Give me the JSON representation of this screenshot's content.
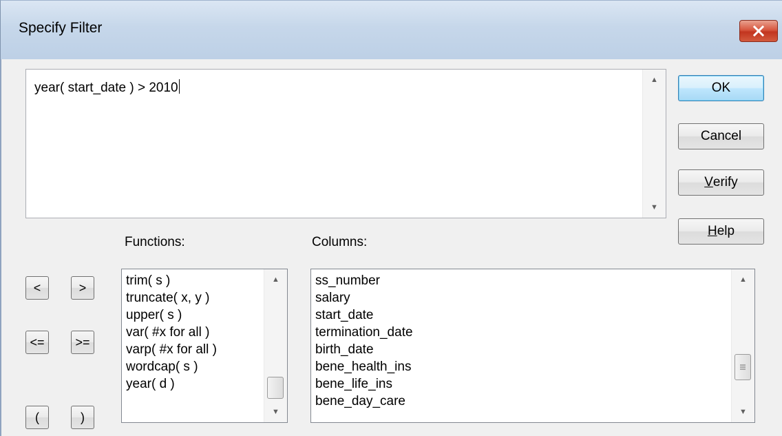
{
  "window": {
    "title": "Specify Filter"
  },
  "editor": {
    "text": "year( start_date ) > 2010"
  },
  "buttons": {
    "ok": "OK",
    "cancel": "Cancel",
    "verify_accel": "V",
    "verify_rest": "erify",
    "help_accel": "H",
    "help_rest": "elp"
  },
  "operators": [
    "<",
    ">",
    "<=",
    ">=",
    "(",
    ")"
  ],
  "functions": {
    "label": "Functions:",
    "items": [
      "trim( s )",
      "truncate( x, y )",
      "upper( s )",
      "var( #x for all )",
      "varp( #x for all )",
      "wordcap( s )",
      "year( d )"
    ]
  },
  "columns": {
    "label": "Columns:",
    "items": [
      "ss_number",
      "salary",
      "start_date",
      "termination_date",
      "birth_date",
      "bene_health_ins",
      "bene_life_ins",
      "bene_day_care"
    ]
  },
  "icons": {
    "close": "close-icon",
    "scroll_up": "scroll-up-arrow-icon",
    "scroll_down": "scroll-down-arrow-icon"
  }
}
